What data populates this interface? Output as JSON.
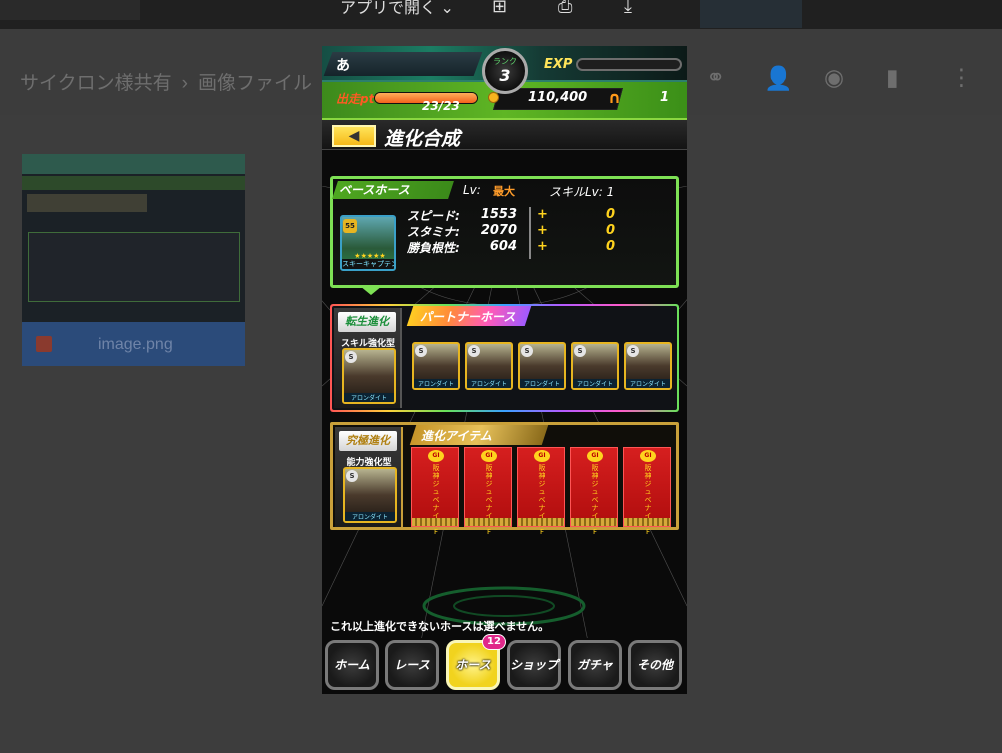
{
  "viewer": {
    "open_with": "アプリで開く",
    "icons": [
      "add-to-drive-icon",
      "print-icon",
      "download-icon",
      "more-vert-icon"
    ]
  },
  "drive": {
    "breadcrumb": [
      "サイクロン様共有",
      "画像ファイル"
    ],
    "actions": [
      "link-icon",
      "share-icon",
      "preview-icon",
      "delete-icon",
      "more-icon"
    ],
    "file": {
      "name": "image.png"
    }
  },
  "game": {
    "player": {
      "name": "あ",
      "rank_label": "ランク",
      "rank": "3",
      "exp_label": "EXP"
    },
    "status": {
      "pt_label": "出走pt",
      "pt": "23/23",
      "pt_fill": 1.0,
      "gold": "110,400",
      "tickets": "1"
    },
    "title": "進化合成",
    "base": {
      "header": "ベースホース",
      "lv_label": "Lv:",
      "lv_value": "最大",
      "skill_lv": "スキルLv: 1",
      "horse_name": "スキーキャプテン",
      "stats": [
        {
          "label": "スピード:",
          "value": "1553",
          "bonus": "0"
        },
        {
          "label": "スタミナ:",
          "value": "2070",
          "bonus": "0"
        },
        {
          "label": "勝負根性:",
          "value": "604",
          "bonus": "0"
        }
      ]
    },
    "rebirth": {
      "tag": "転生進化",
      "type": "スキル強化型",
      "horse_name": "アロンダイト",
      "partner_header": "パートナーホース",
      "partners": [
        "アロンダイト",
        "アロンダイト",
        "アロンダイト",
        "アロンダイト",
        "アロンダイト"
      ]
    },
    "ultimate": {
      "tag": "究極進化",
      "type": "能力強化型",
      "horse_name": "アロンダイト",
      "item_header": "進化アイテム",
      "items": [
        {
          "top": "GI",
          "text": "阪神ジュベナイルF"
        },
        {
          "top": "GI",
          "text": "阪神ジュベナイルF"
        },
        {
          "top": "GI",
          "text": "阪神ジュベナイルF"
        },
        {
          "top": "GI",
          "text": "阪神ジュベナイルF"
        },
        {
          "top": "GI",
          "text": "阪神ジュベナイルF"
        }
      ]
    },
    "notice": "これ以上進化できないホースは選べません。",
    "nav": [
      {
        "label": "ホーム"
      },
      {
        "label": "レース"
      },
      {
        "label": "ホース",
        "active": true,
        "badge": "12"
      },
      {
        "label": "ショップ"
      },
      {
        "label": "ガチャ"
      },
      {
        "label": "その他"
      }
    ]
  }
}
